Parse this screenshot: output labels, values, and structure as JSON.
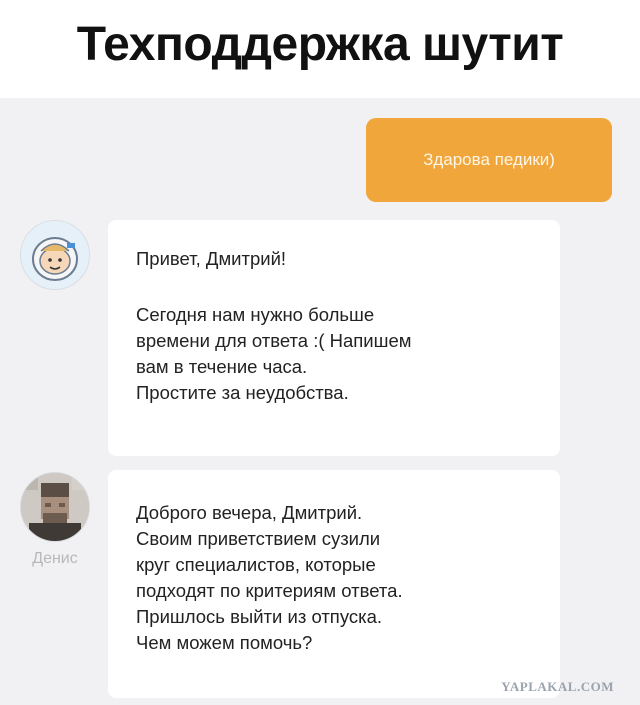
{
  "headline": "Техподдержка шутит",
  "chat": {
    "outgoing_message": "Здарова педики)",
    "incoming_1": {
      "greeting": "Привет, Дмитрий!",
      "lines": [
        "Сегодня нам нужно больше",
        "времени для ответа :( Напишем",
        "вам в течение часа.",
        "Простите за неудобства."
      ]
    },
    "incoming_2": {
      "sender_name": "Денис",
      "lines": [
        "Доброго вечера, Дмитрий.",
        "Своим приветствием сузили",
        "круг специалистов, которые",
        "подходят по критериям ответа.",
        "Пришлось выйти из отпуска.",
        "Чем можем помочь?"
      ]
    }
  },
  "watermark": "YAPLAKAL.COM",
  "colors": {
    "outgoing_bubble": "#f0a63b",
    "chat_background": "#f1f1f3",
    "incoming_bubble": "#ffffff"
  }
}
